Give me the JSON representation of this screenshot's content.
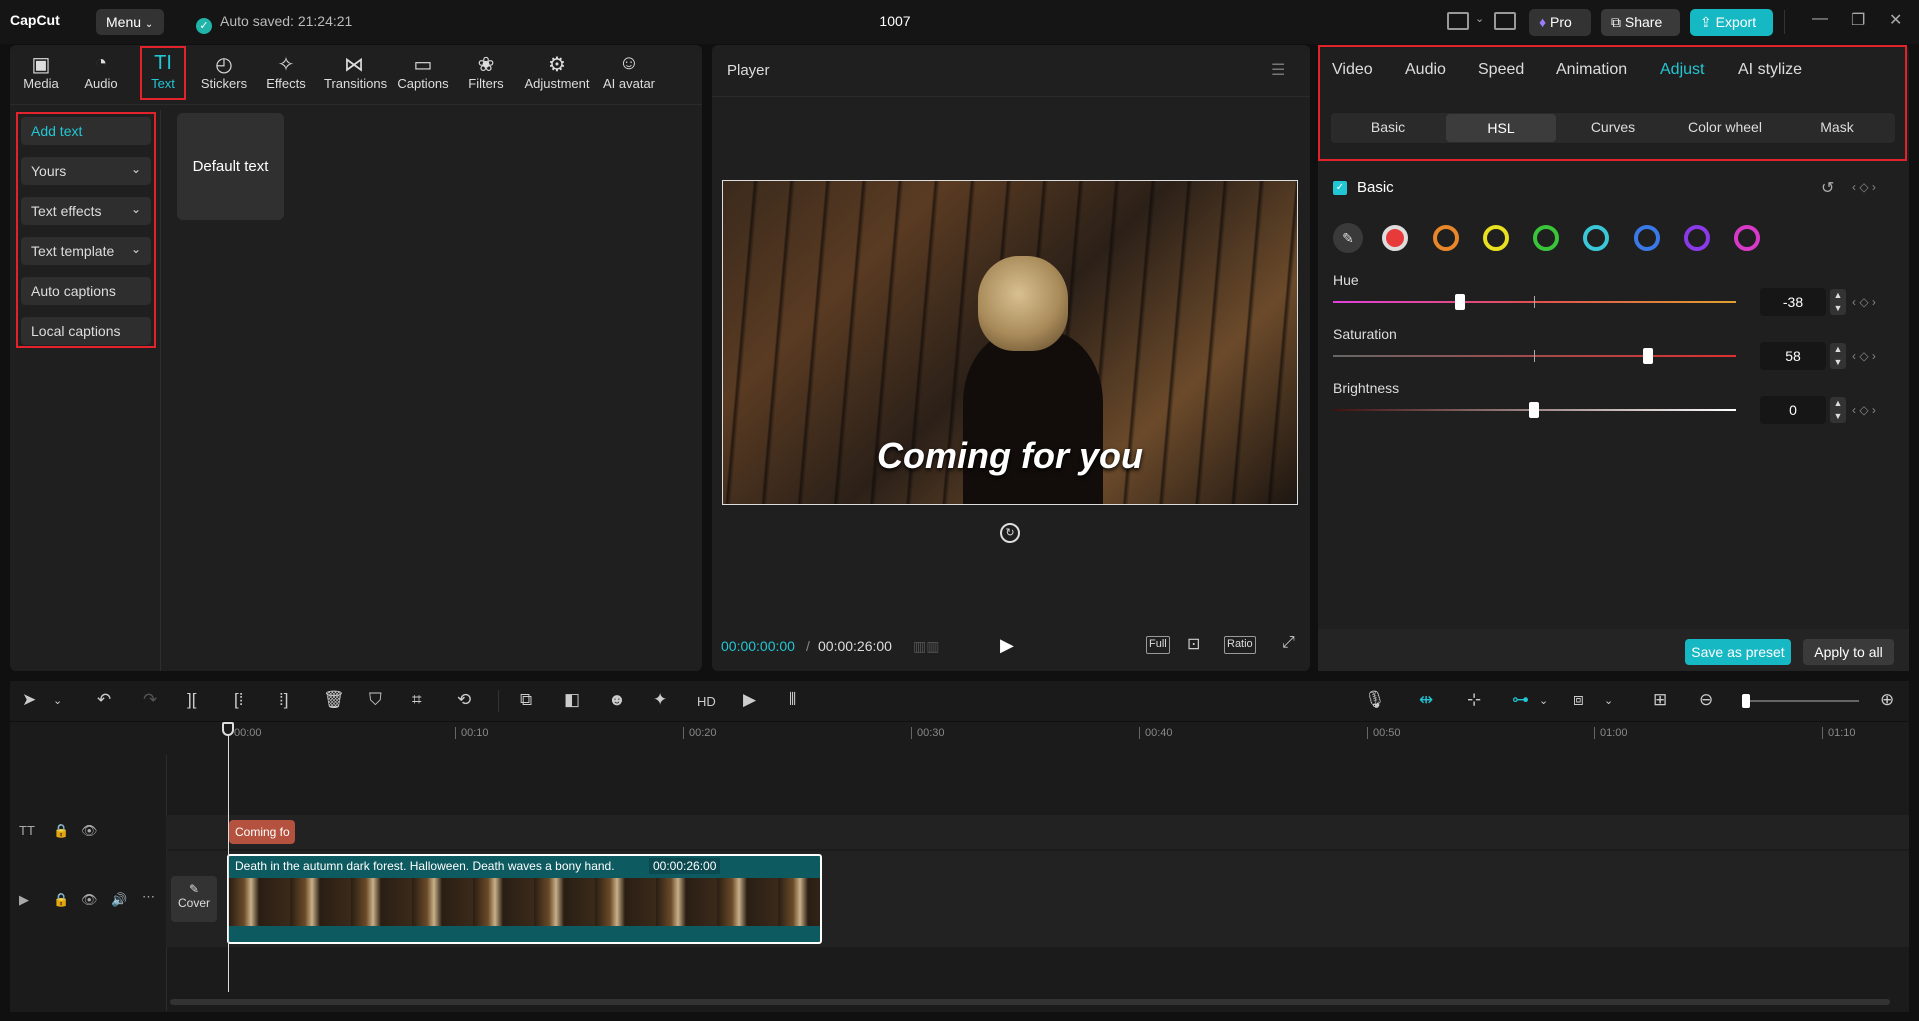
{
  "app": {
    "logo": "CapCut",
    "menu_label": "Menu",
    "autosave": "Auto saved: 21:24:21",
    "project_title": "1007",
    "pro_label": "Pro",
    "share_label": "Share",
    "export_label": "Export"
  },
  "tools": [
    {
      "label": "Media"
    },
    {
      "label": "Audio"
    },
    {
      "label": "Text"
    },
    {
      "label": "Stickers"
    },
    {
      "label": "Effects"
    },
    {
      "label": "Transitions"
    },
    {
      "label": "Captions"
    },
    {
      "label": "Filters"
    },
    {
      "label": "Adjustment"
    },
    {
      "label": "AI avatar"
    }
  ],
  "text_sidebar": {
    "add_text": "Add text",
    "yours": "Yours",
    "text_effects": "Text effects",
    "text_template": "Text template",
    "auto_captions": "Auto captions",
    "local_captions": "Local captions"
  },
  "default_text_card": "Default text",
  "player": {
    "title": "Player",
    "overlay_text": "Coming for you",
    "current_time": "00:00:00:00",
    "total_time": "00:00:26:00",
    "full_label": "Full",
    "ratio_label": "Ratio"
  },
  "properties": {
    "tabs": [
      "Video",
      "Audio",
      "Speed",
      "Animation",
      "Adjust",
      "AI stylize"
    ],
    "subtabs": [
      "Basic",
      "HSL",
      "Curves",
      "Color wheel",
      "Mask"
    ],
    "section_label": "Basic",
    "hue_label": "Hue",
    "hue_value": "-38",
    "saturation_label": "Saturation",
    "saturation_value": "58",
    "brightness_label": "Brightness",
    "brightness_value": "0",
    "save_preset": "Save as preset",
    "apply_all": "Apply to all",
    "color_swatches": [
      "#e83a3a",
      "#e8872a",
      "#e8e020",
      "#3ac43a",
      "#3ac8d8",
      "#3a7ae8",
      "#8a3ae8",
      "#d83ac8"
    ]
  },
  "timeline": {
    "ruler": [
      "00:00",
      "00:10",
      "00:20",
      "00:30",
      "00:40",
      "00:50",
      "01:00",
      "01:10"
    ],
    "text_clip": "Coming fo",
    "video_clip_title": "Death in the autumn dark forest. Halloween. Death waves a bony hand.",
    "video_clip_duration": "00:00:26:00",
    "cover_label": "Cover"
  },
  "colors": {
    "accent": "#22c6d4",
    "highlight_box": "#e3232b"
  }
}
